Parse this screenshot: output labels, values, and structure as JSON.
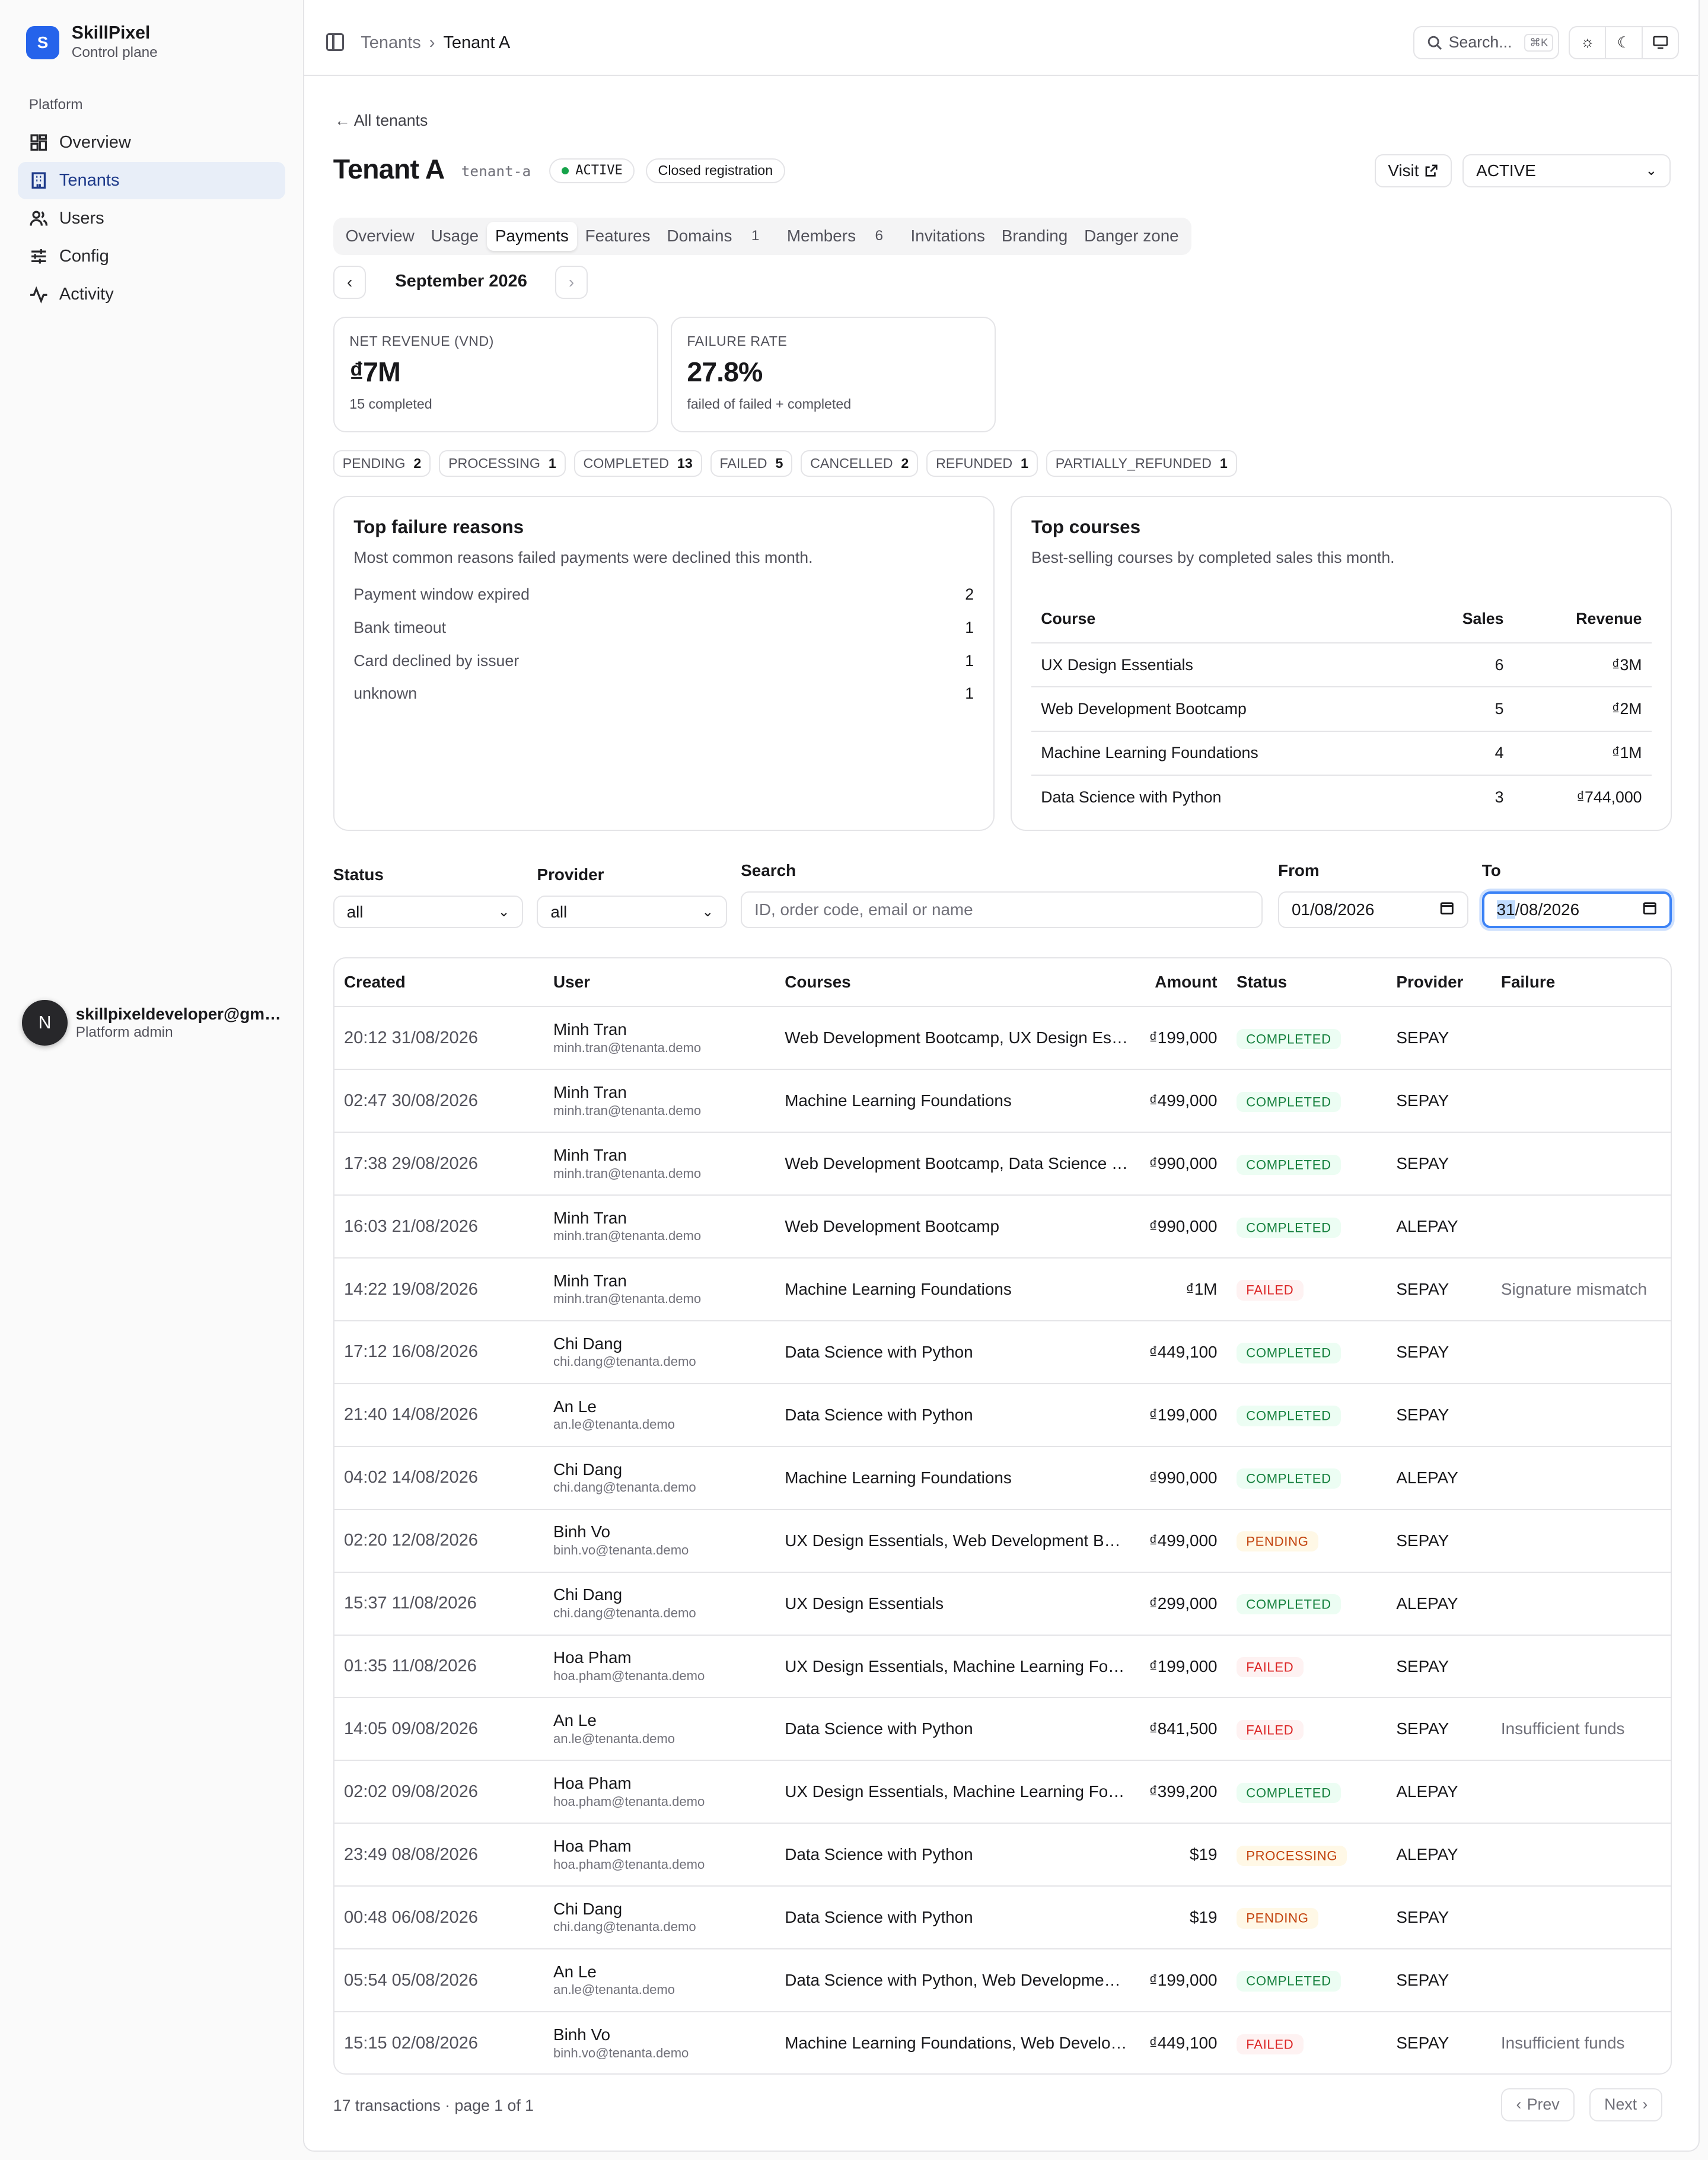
{
  "brand": {
    "logo": "S",
    "name": "SkillPixel",
    "subtitle": "Control plane"
  },
  "sidebar": {
    "section": "Platform",
    "items": [
      {
        "label": "Overview",
        "icon": "grid-icon",
        "active": false
      },
      {
        "label": "Tenants",
        "icon": "building-icon",
        "active": true
      },
      {
        "label": "Users",
        "icon": "users-icon",
        "active": false
      },
      {
        "label": "Config",
        "icon": "sliders-icon",
        "active": false
      },
      {
        "label": "Activity",
        "icon": "activity-icon",
        "active": false
      }
    ]
  },
  "user": {
    "initial": "N",
    "email": "skillpixeldeveloper@gm…",
    "role": "Platform admin"
  },
  "topbar": {
    "breadcrumb": [
      "Tenants",
      "Tenant A"
    ],
    "search": "Search...",
    "shortcut": "⌘K"
  },
  "header": {
    "back": "All tenants",
    "title": "Tenant A",
    "slug": "tenant-a",
    "status_badge": "ACTIVE",
    "registration_badge": "Closed registration",
    "visit": "Visit",
    "status_select": "ACTIVE"
  },
  "tabs": [
    {
      "label": "Overview",
      "count": ""
    },
    {
      "label": "Usage",
      "count": ""
    },
    {
      "label": "Payments",
      "count": "",
      "active": true
    },
    {
      "label": "Features",
      "count": ""
    },
    {
      "label": "Domains",
      "count": "1"
    },
    {
      "label": "Members",
      "count": "6"
    },
    {
      "label": "Invitations",
      "count": ""
    },
    {
      "label": "Branding",
      "count": ""
    },
    {
      "label": "Danger zone",
      "count": ""
    }
  ],
  "month": "September 2026",
  "stats": {
    "revenue": {
      "label": "NET REVENUE (VND)",
      "value": "₫7M",
      "sub": "15 completed"
    },
    "failure": {
      "label": "FAILURE RATE",
      "value": "27.8%",
      "sub": "failed of failed + completed"
    }
  },
  "status_counts": [
    {
      "label": "PENDING",
      "count": "2"
    },
    {
      "label": "PROCESSING",
      "count": "1"
    },
    {
      "label": "COMPLETED",
      "count": "13"
    },
    {
      "label": "FAILED",
      "count": "5"
    },
    {
      "label": "CANCELLED",
      "count": "2"
    },
    {
      "label": "REFUNDED",
      "count": "1"
    },
    {
      "label": "PARTIALLY_REFUNDED",
      "count": "1"
    }
  ],
  "failure_reasons": {
    "title": "Top failure reasons",
    "subtitle": "Most common reasons failed payments were declined this month.",
    "items": [
      {
        "reason": "Payment window expired",
        "count": "2"
      },
      {
        "reason": "Bank timeout",
        "count": "1"
      },
      {
        "reason": "Card declined by issuer",
        "count": "1"
      },
      {
        "reason": "unknown",
        "count": "1"
      }
    ]
  },
  "top_courses": {
    "title": "Top courses",
    "subtitle": "Best-selling courses by completed sales this month.",
    "headers": [
      "Course",
      "Sales",
      "Revenue"
    ],
    "rows": [
      {
        "course": "UX Design Essentials",
        "sales": "6",
        "revenue": "₫3M"
      },
      {
        "course": "Web Development Bootcamp",
        "sales": "5",
        "revenue": "₫2M"
      },
      {
        "course": "Machine Learning Foundations",
        "sales": "4",
        "revenue": "₫1M"
      },
      {
        "course": "Data Science with Python",
        "sales": "3",
        "revenue": "₫744,000"
      }
    ]
  },
  "filters": {
    "status_label": "Status",
    "status_value": "all",
    "provider_label": "Provider",
    "provider_value": "all",
    "search_label": "Search",
    "search_placeholder": "ID, order code, email or name",
    "from_label": "From",
    "from_value": "01/08/2026",
    "to_label": "To",
    "to_day": "31",
    "to_rest": "/08/2026"
  },
  "transactions": {
    "headers": [
      "Created",
      "User",
      "Courses",
      "Amount",
      "Status",
      "Provider",
      "Failure"
    ],
    "rows": [
      {
        "created": "20:12 31/08/2026",
        "name": "Minh Tran",
        "email": "minh.tran@tenanta.demo",
        "courses": "Web Development Bootcamp, UX Design Essentials",
        "amount": "₫199,000",
        "status": "COMPLETED",
        "provider": "SEPAY",
        "failure": ""
      },
      {
        "created": "02:47 30/08/2026",
        "name": "Minh Tran",
        "email": "minh.tran@tenanta.demo",
        "courses": "Machine Learning Foundations",
        "amount": "₫499,000",
        "status": "COMPLETED",
        "provider": "SEPAY",
        "failure": ""
      },
      {
        "created": "17:38 29/08/2026",
        "name": "Minh Tran",
        "email": "minh.tran@tenanta.demo",
        "courses": "Web Development Bootcamp, Data Science with Python",
        "amount": "₫990,000",
        "status": "COMPLETED",
        "provider": "SEPAY",
        "failure": ""
      },
      {
        "created": "16:03 21/08/2026",
        "name": "Minh Tran",
        "email": "minh.tran@tenanta.demo",
        "courses": "Web Development Bootcamp",
        "amount": "₫990,000",
        "status": "COMPLETED",
        "provider": "ALEPAY",
        "failure": ""
      },
      {
        "created": "14:22 19/08/2026",
        "name": "Minh Tran",
        "email": "minh.tran@tenanta.demo",
        "courses": "Machine Learning Foundations",
        "amount": "₫1M",
        "status": "FAILED",
        "provider": "SEPAY",
        "failure": "Signature mismatch"
      },
      {
        "created": "17:12 16/08/2026",
        "name": "Chi Dang",
        "email": "chi.dang@tenanta.demo",
        "courses": "Data Science with Python",
        "amount": "₫449,100",
        "status": "COMPLETED",
        "provider": "SEPAY",
        "failure": ""
      },
      {
        "created": "21:40 14/08/2026",
        "name": "An Le",
        "email": "an.le@tenanta.demo",
        "courses": "Data Science with Python",
        "amount": "₫199,000",
        "status": "COMPLETED",
        "provider": "SEPAY",
        "failure": ""
      },
      {
        "created": "04:02 14/08/2026",
        "name": "Chi Dang",
        "email": "chi.dang@tenanta.demo",
        "courses": "Machine Learning Foundations",
        "amount": "₫990,000",
        "status": "COMPLETED",
        "provider": "ALEPAY",
        "failure": ""
      },
      {
        "created": "02:20 12/08/2026",
        "name": "Binh Vo",
        "email": "binh.vo@tenanta.demo",
        "courses": "UX Design Essentials, Web Development Bootcamp",
        "amount": "₫499,000",
        "status": "PENDING",
        "provider": "SEPAY",
        "failure": ""
      },
      {
        "created": "15:37 11/08/2026",
        "name": "Chi Dang",
        "email": "chi.dang@tenanta.demo",
        "courses": "UX Design Essentials",
        "amount": "₫299,000",
        "status": "COMPLETED",
        "provider": "ALEPAY",
        "failure": ""
      },
      {
        "created": "01:35 11/08/2026",
        "name": "Hoa Pham",
        "email": "hoa.pham@tenanta.demo",
        "courses": "UX Design Essentials, Machine Learning Foundations",
        "amount": "₫199,000",
        "status": "FAILED",
        "provider": "SEPAY",
        "failure": ""
      },
      {
        "created": "14:05 09/08/2026",
        "name": "An Le",
        "email": "an.le@tenanta.demo",
        "courses": "Data Science with Python",
        "amount": "₫841,500",
        "status": "FAILED",
        "provider": "SEPAY",
        "failure": "Insufficient funds"
      },
      {
        "created": "02:02 09/08/2026",
        "name": "Hoa Pham",
        "email": "hoa.pham@tenanta.demo",
        "courses": "UX Design Essentials, Machine Learning Foundations",
        "amount": "₫399,200",
        "status": "COMPLETED",
        "provider": "ALEPAY",
        "failure": ""
      },
      {
        "created": "23:49 08/08/2026",
        "name": "Hoa Pham",
        "email": "hoa.pham@tenanta.demo",
        "courses": "Data Science with Python",
        "amount": "$19",
        "status": "PROCESSING",
        "provider": "ALEPAY",
        "failure": ""
      },
      {
        "created": "00:48 06/08/2026",
        "name": "Chi Dang",
        "email": "chi.dang@tenanta.demo",
        "courses": "Data Science with Python",
        "amount": "$19",
        "status": "PENDING",
        "provider": "SEPAY",
        "failure": ""
      },
      {
        "created": "05:54 05/08/2026",
        "name": "An Le",
        "email": "an.le@tenanta.demo",
        "courses": "Data Science with Python, Web Development Bootcamp",
        "amount": "₫199,000",
        "status": "COMPLETED",
        "provider": "SEPAY",
        "failure": ""
      },
      {
        "created": "15:15 02/08/2026",
        "name": "Binh Vo",
        "email": "binh.vo@tenanta.demo",
        "courses": "Machine Learning Foundations, Web Development Bootcamp",
        "amount": "₫449,100",
        "status": "FAILED",
        "provider": "SEPAY",
        "failure": "Insufficient funds"
      }
    ]
  },
  "footer": {
    "summary": "17 transactions · page 1 of 1",
    "prev": "Prev",
    "next": "Next"
  }
}
